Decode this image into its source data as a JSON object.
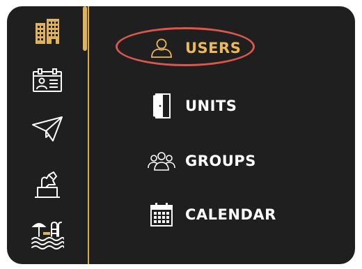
{
  "rail": {
    "items": [
      {
        "icon": "buildings-icon"
      },
      {
        "icon": "id-card-icon"
      },
      {
        "icon": "paper-plane-icon"
      },
      {
        "icon": "hand-ballot-icon"
      },
      {
        "icon": "pool-icon"
      }
    ]
  },
  "menu": {
    "items": [
      {
        "label": "USERS",
        "icon": "user-icon",
        "active": true
      },
      {
        "label": "UNITS",
        "icon": "door-icon"
      },
      {
        "label": "GROUPS",
        "icon": "group-icon"
      },
      {
        "label": "CALENDAR",
        "icon": "calendar-icon"
      }
    ]
  },
  "colors": {
    "background": "#1f1f1f",
    "accent": "#ecb95a",
    "highlight": "#d9574f",
    "text": "#ffffff"
  }
}
